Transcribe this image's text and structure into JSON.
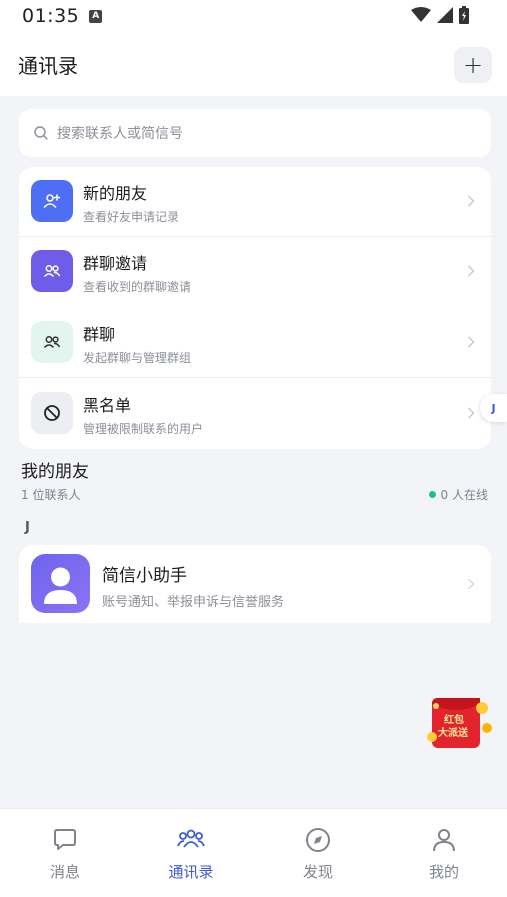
{
  "status": {
    "time": "01:35",
    "a_icon": "A"
  },
  "header": {
    "title": "通讯录",
    "add_label": "+"
  },
  "search": {
    "placeholder": "搜索联系人或简信号"
  },
  "menu": [
    {
      "title": "新的朋友",
      "subtitle": "查看好友申请记录",
      "icon": "add-user-icon",
      "color": "#4d6ef5"
    },
    {
      "title": "群聊邀请",
      "subtitle": "查看收到的群聊邀请",
      "icon": "group-invite-icon",
      "color": "#6f5ce8"
    },
    {
      "title": "群聊",
      "subtitle": "发起群聊与管理群组",
      "icon": "group-icon",
      "color": "#e3f5ef"
    },
    {
      "title": "黑名单",
      "subtitle": "管理被限制联系的用户",
      "icon": "block-icon",
      "color": "#eceef2"
    }
  ],
  "index_letter": "J",
  "friends": {
    "title": "我的朋友",
    "count": "1 位联系人",
    "online": "0 人在线"
  },
  "section": {
    "letter": "J"
  },
  "contact": {
    "name": "简信小助手",
    "desc": "账号通知、举报申诉与信誉服务"
  },
  "promo": {
    "line1": "红包",
    "line2": "大派送"
  },
  "tabs": [
    {
      "label": "消息",
      "icon": "message-icon",
      "active": false
    },
    {
      "label": "通讯录",
      "icon": "contacts-icon",
      "active": true
    },
    {
      "label": "发现",
      "icon": "compass-icon",
      "active": false
    },
    {
      "label": "我的",
      "icon": "profile-icon",
      "active": false
    }
  ],
  "colors": {
    "accent": "#3b5bdb",
    "online": "#1fbf8f",
    "background": "#f3f4f7"
  }
}
